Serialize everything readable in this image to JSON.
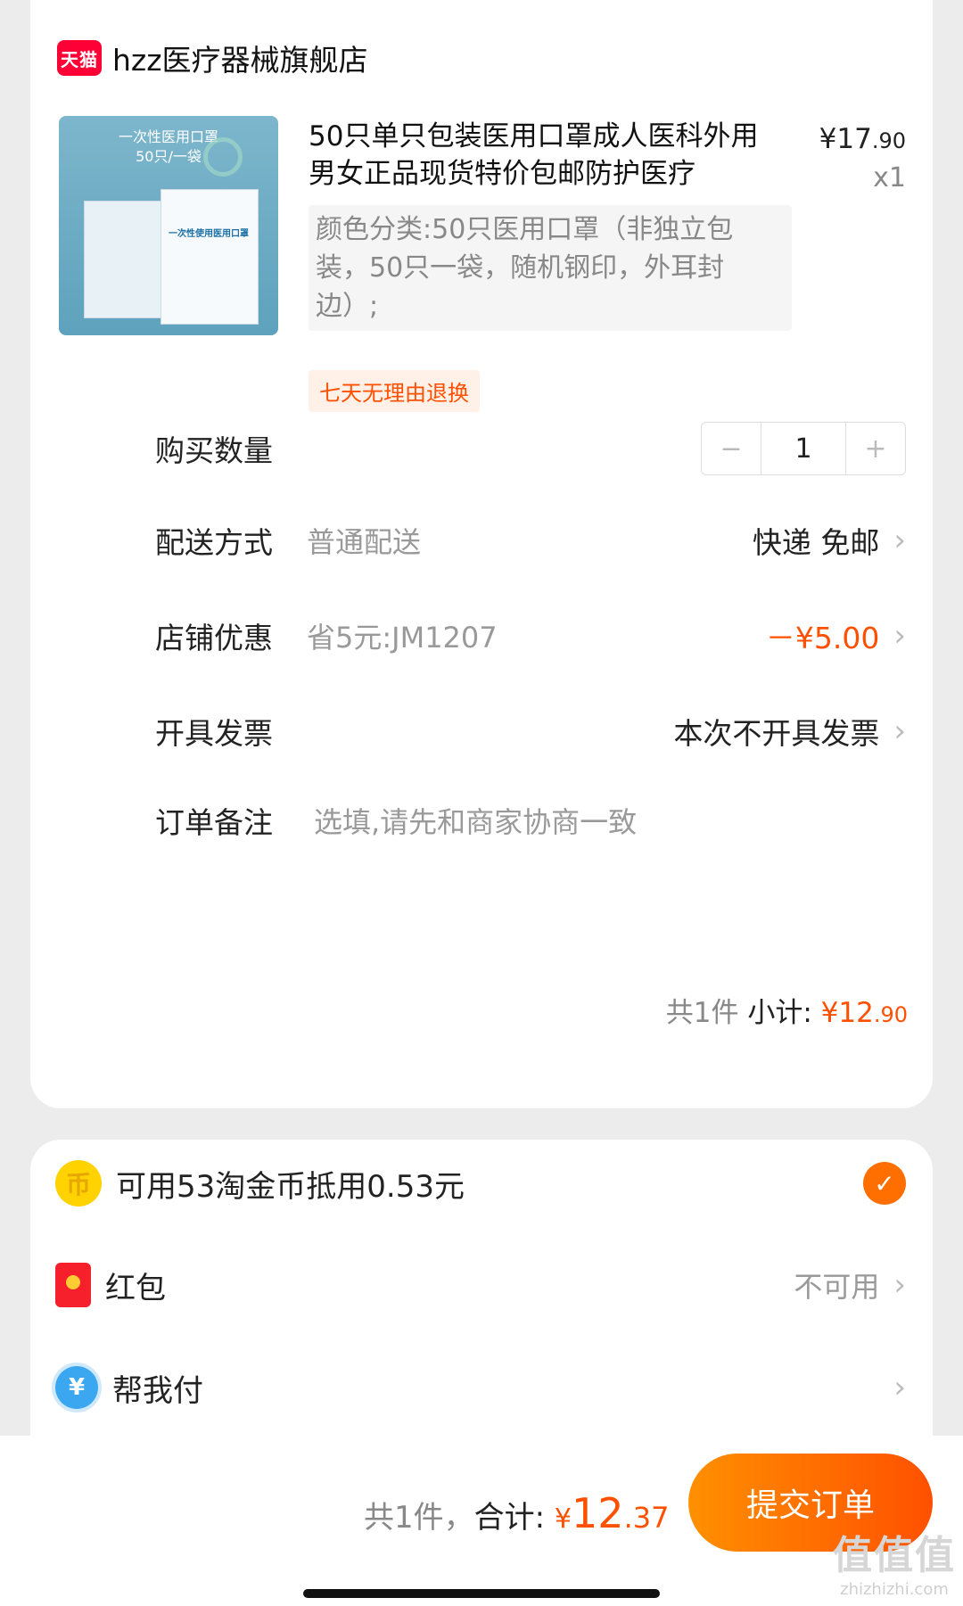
{
  "store": {
    "logo_text": "天猫",
    "name": "hzz医疗器械旗舰店"
  },
  "product": {
    "thumb_title": "一次性医用口罩",
    "thumb_sub": "50只/一袋",
    "thumb_pack_label": "一次性使用医用口罩",
    "title": "50只单只包装医用口罩成人医科外用男女正品现货特价包邮防护医疗",
    "price_symbol": "¥",
    "price_int": "17",
    "price_dec": ".90",
    "quantity_label": "x1",
    "sku": "颜色分类:50只医用口罩（非独立包装，50只一袋，随机钢印，外耳封边）;",
    "tag": "七天无理由退换"
  },
  "order": {
    "qty_label": "购买数量",
    "qty_minus": "−",
    "qty_value": "1",
    "qty_plus": "+",
    "delivery_label": "配送方式",
    "delivery_sub": "普通配送",
    "delivery_value": "快递 免邮",
    "coupon_label": "店铺优惠",
    "coupon_sub": "省5元:JM1207",
    "coupon_value": "－¥5.00",
    "invoice_label": "开具发票",
    "invoice_value": "本次不开具发票",
    "note_label": "订单备注",
    "note_placeholder": "选填,请先和商家协商一致",
    "subtotal_count": "共1件",
    "subtotal_label": "小计:",
    "subtotal_symbol": "¥",
    "subtotal_int": "12",
    "subtotal_dec": ".90"
  },
  "benefits": {
    "coin_glyph": "币",
    "coin_label": "可用53淘金币抵用0.53元",
    "coin_checked": true,
    "redpack_label": "红包",
    "redpack_value": "不可用",
    "helppay_glyph": "¥",
    "helppay_label": "帮我付"
  },
  "footer": {
    "count": "共1件，",
    "total_label": "合计:",
    "total_symbol": "¥",
    "total_int": "12",
    "total_dec": ".37",
    "submit_label": "提交订单",
    "watermark_big": "值值值",
    "watermark_small": "zhizhizhi.com"
  },
  "colors": {
    "accent": "#ff5000",
    "brand_red": "#ff0036",
    "coin": "#ffd200"
  },
  "icons": [
    "tmall-logo",
    "chevron-right-icon",
    "coin-icon",
    "red-packet-icon",
    "help-pay-icon",
    "check-icon"
  ]
}
